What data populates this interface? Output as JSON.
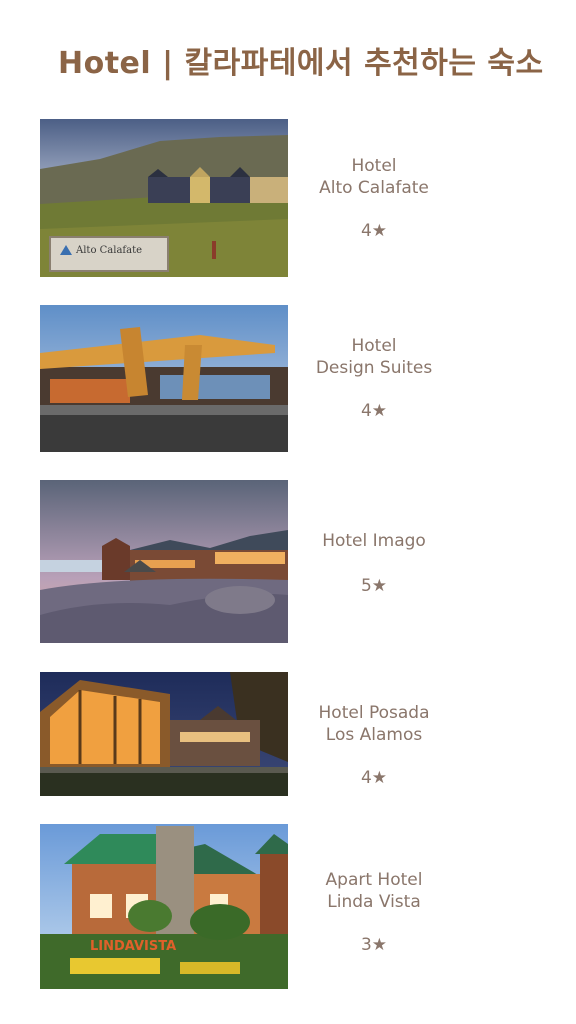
{
  "title": "Hotel | 칼라파테에서 추천하는 숙소",
  "hotels": [
    {
      "name": "Hotel\nAlto Calafate",
      "rating": "4★",
      "sign_text": "Alto Calafate"
    },
    {
      "name": "Hotel\nDesign Suites",
      "rating": "4★"
    },
    {
      "name": "Hotel Imago",
      "rating": "5★"
    },
    {
      "name": "Hotel Posada\nLos Alamos",
      "rating": "4★"
    },
    {
      "name": "Apart Hotel\nLinda Vista",
      "rating": "3★",
      "sign_text": "LINDAVISTA"
    }
  ],
  "colors": {
    "title": "#8b6446",
    "text": "#8a766b",
    "background": "#ffffff"
  }
}
